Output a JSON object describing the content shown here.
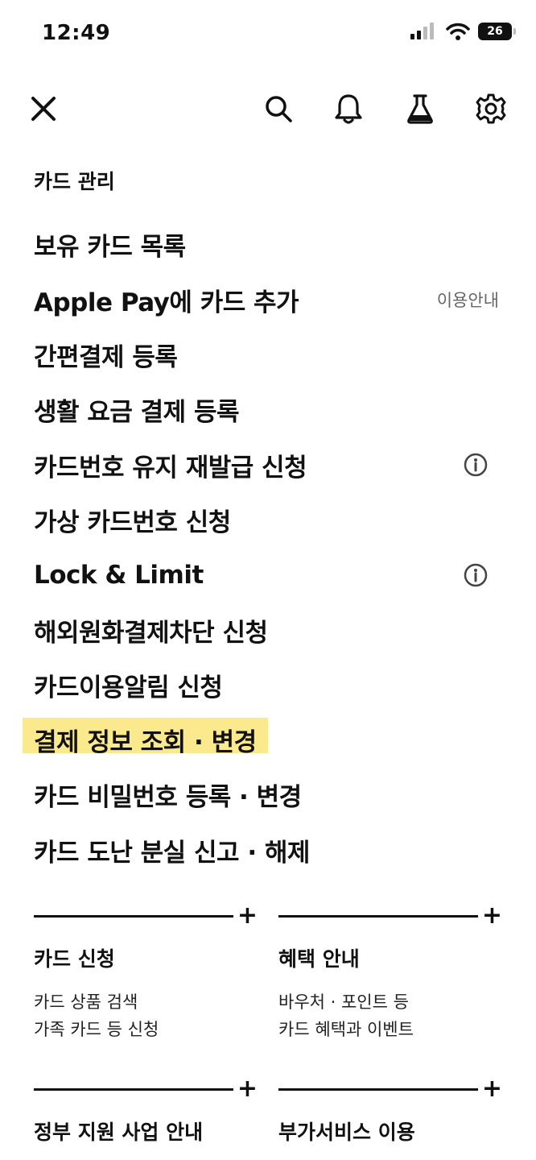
{
  "status_bar": {
    "time": "12:49",
    "battery": "26"
  },
  "toolbar": {
    "close_icon": "close-icon",
    "search_icon": "search-icon",
    "bell_icon": "bell-icon",
    "lab_icon": "flask-icon",
    "settings_icon": "gear-icon"
  },
  "section": {
    "title": "카드 관리",
    "items": [
      {
        "label": "보유 카드 목록"
      },
      {
        "label": "Apple Pay에 카드 추가",
        "side_text": "이용안내"
      },
      {
        "label": "간편결제 등록"
      },
      {
        "label": "생활 요금 결제 등록"
      },
      {
        "label": "카드번호 유지 재발급 신청",
        "icon": "info-icon"
      },
      {
        "label": "가상 카드번호 신청"
      },
      {
        "label": "Lock & Limit",
        "icon": "info-icon"
      },
      {
        "label": "해외원화결제차단 신청"
      },
      {
        "label": "카드이용알림 신청"
      },
      {
        "label": "결제 정보 조회 · 변경",
        "highlighted": true
      },
      {
        "label": "카드 비밀번호 등록 · 변경"
      },
      {
        "label": "카드 도난 분실 신고 · 해제"
      }
    ]
  },
  "tiles": [
    {
      "title": "카드 신청",
      "desc1": "카드 상품 검색",
      "desc2": "가족 카드 등 신청"
    },
    {
      "title": "혜택 안내",
      "desc1": "바우처 · 포인트 등",
      "desc2": "카드 혜택과 이벤트"
    },
    {
      "title": "정부 지원 사업 안내",
      "desc1": "",
      "desc2": ""
    },
    {
      "title": "부가서비스 이용",
      "desc1": "",
      "desc2": ""
    }
  ],
  "tile_plus": "+",
  "colors": {
    "highlight": "#fbe98d",
    "text": "#111111",
    "muted": "#666666"
  }
}
